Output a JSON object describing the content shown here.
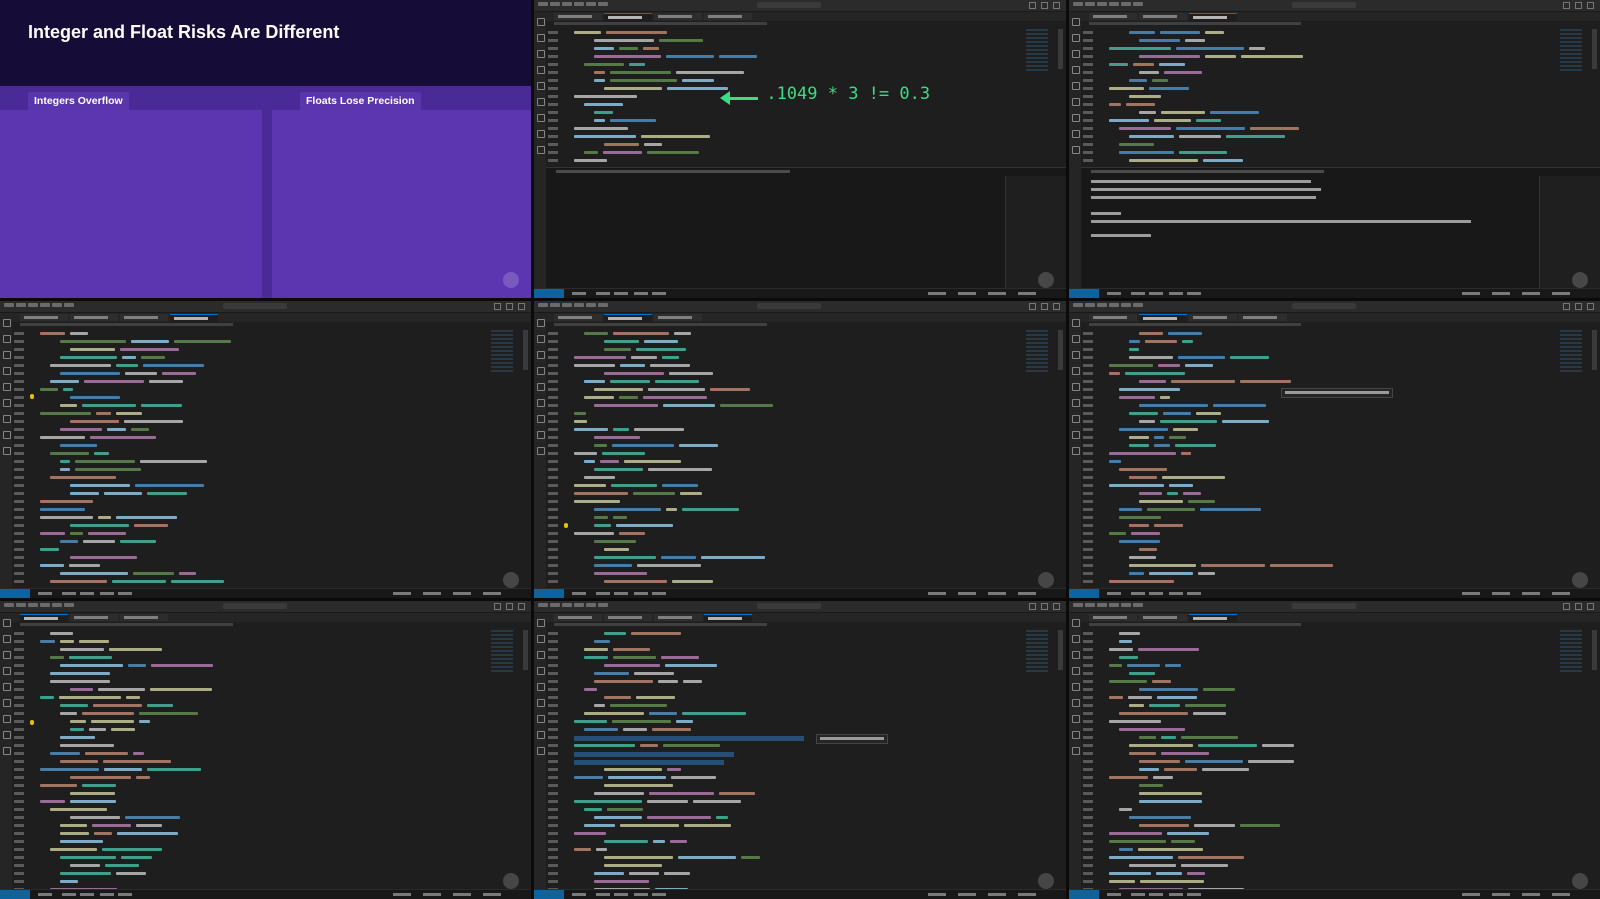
{
  "slide": {
    "title": "Integer and Float Risks Are Different",
    "columns": [
      {
        "label": "Integers Overflow"
      },
      {
        "label": "Floats Lose Precision"
      }
    ]
  },
  "annotation": {
    "text": ".1049 * 3 != 0.3",
    "color": "#3ddc84"
  },
  "colors": {
    "slide_background": "#1a1142",
    "slide_panel": "#5b36b0",
    "editor_background": "#1e1e1e",
    "status_remote": "#0e639c",
    "selection": "#264f78"
  },
  "icons": [
    "arrow-left-icon"
  ]
}
